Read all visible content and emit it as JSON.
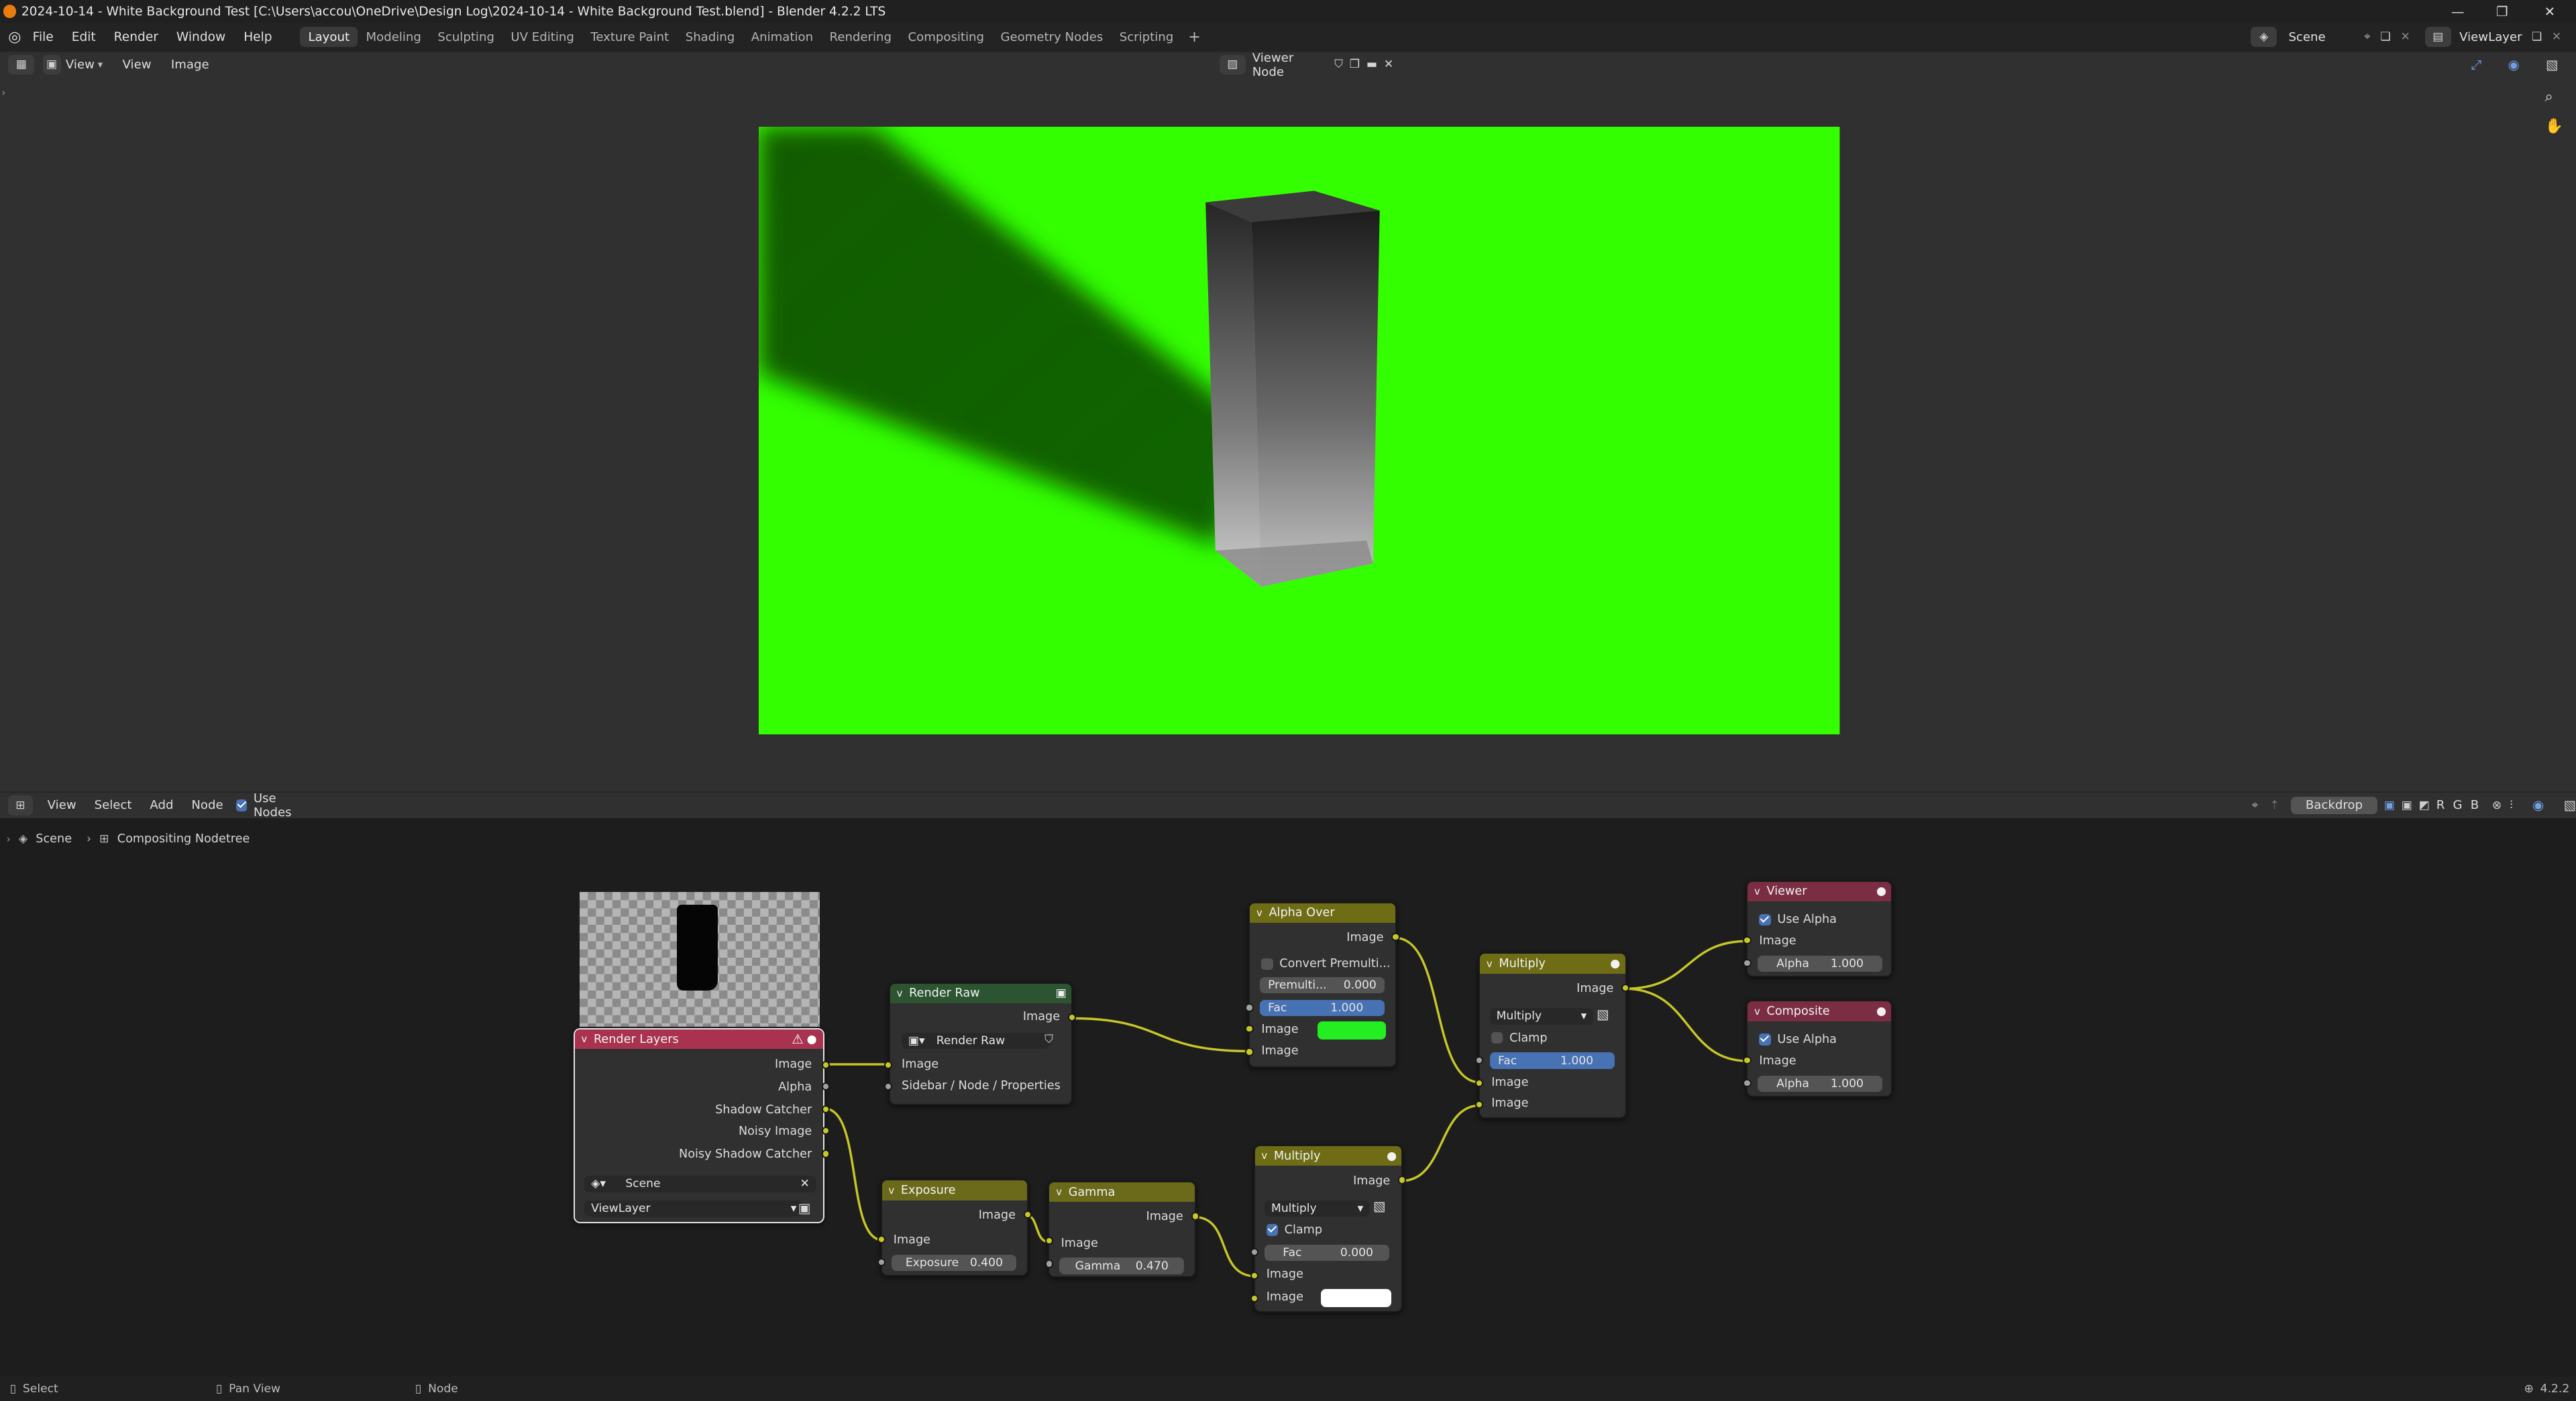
{
  "window": {
    "title": "2024-10-14 - White Background Test [C:\\Users\\accou\\OneDrive\\Design Log\\2024-10-14 - White Background Test.blend] - Blender 4.2.2 LTS"
  },
  "menu": {
    "items": [
      "File",
      "Edit",
      "Render",
      "Window",
      "Help"
    ]
  },
  "workspaces": [
    "Layout",
    "Modeling",
    "Sculpting",
    "UV Editing",
    "Texture Paint",
    "Shading",
    "Animation",
    "Rendering",
    "Compositing",
    "Geometry Nodes",
    "Scripting"
  ],
  "active_workspace": "Layout",
  "scene_field": "Scene",
  "viewlayer_field": "ViewLayer",
  "image_editor": {
    "menus": [
      "View",
      "View",
      "Image"
    ],
    "image_name": "Viewer Node",
    "background_color": "#33ff00"
  },
  "node_editor": {
    "menus": [
      "View",
      "Select",
      "Add",
      "Node"
    ],
    "use_nodes": "Use Nodes",
    "backdrop": "Backdrop",
    "channels": [
      "R",
      "G",
      "B"
    ],
    "breadcrumb": [
      "Scene",
      "Compositing Nodetree"
    ]
  },
  "nodes": {
    "render_layers": {
      "title": "Render Layers",
      "outputs": [
        "Image",
        "Alpha",
        "Shadow Catcher",
        "Noisy Image",
        "Noisy Shadow Catcher"
      ],
      "scene": "Scene",
      "layer": "ViewLayer"
    },
    "render_raw": {
      "title": "Render Raw",
      "out": "Image",
      "group": "Render Raw",
      "in": "Image",
      "hint": "Sidebar / Node / Properties"
    },
    "alpha_over": {
      "title": "Alpha Over",
      "out": "Image",
      "convert": "Convert Premulti...",
      "premul_label": "Premulti...",
      "premul_value": "0.000",
      "fac_label": "Fac",
      "fac_value": "1.000",
      "in1": "Image",
      "in2": "Image",
      "color": "#22ee22"
    },
    "multiply_top": {
      "title": "Multiply",
      "out": "Image",
      "mode": "Multiply",
      "clamp": "Clamp",
      "fac_label": "Fac",
      "fac_value": "1.000",
      "in1": "Image",
      "in2": "Image"
    },
    "viewer": {
      "title": "Viewer",
      "use_alpha": "Use Alpha",
      "in": "Image",
      "alpha_label": "Alpha",
      "alpha_value": "1.000"
    },
    "composite": {
      "title": "Composite",
      "use_alpha": "Use Alpha",
      "in": "Image",
      "alpha_label": "Alpha",
      "alpha_value": "1.000"
    },
    "exposure": {
      "title": "Exposure",
      "out": "Image",
      "in": "Image",
      "label": "Exposure",
      "value": "0.400"
    },
    "gamma": {
      "title": "Gamma",
      "out": "Image",
      "in": "Image",
      "label": "Gamma",
      "value": "0.470"
    },
    "multiply_bottom": {
      "title": "Multiply",
      "out": "Image",
      "mode": "Multiply",
      "clamp": "Clamp",
      "fac_label": "Fac",
      "fac_value": "0.000",
      "in1": "Image",
      "in2": "Image",
      "color": "#ffffff"
    }
  },
  "status": {
    "select": "Select",
    "pan": "Pan View",
    "node": "Node",
    "version": "4.2.2"
  },
  "colors": {
    "socket_color": "#c7c729",
    "link_color": "#c7c729",
    "accent": "#4772b3"
  }
}
